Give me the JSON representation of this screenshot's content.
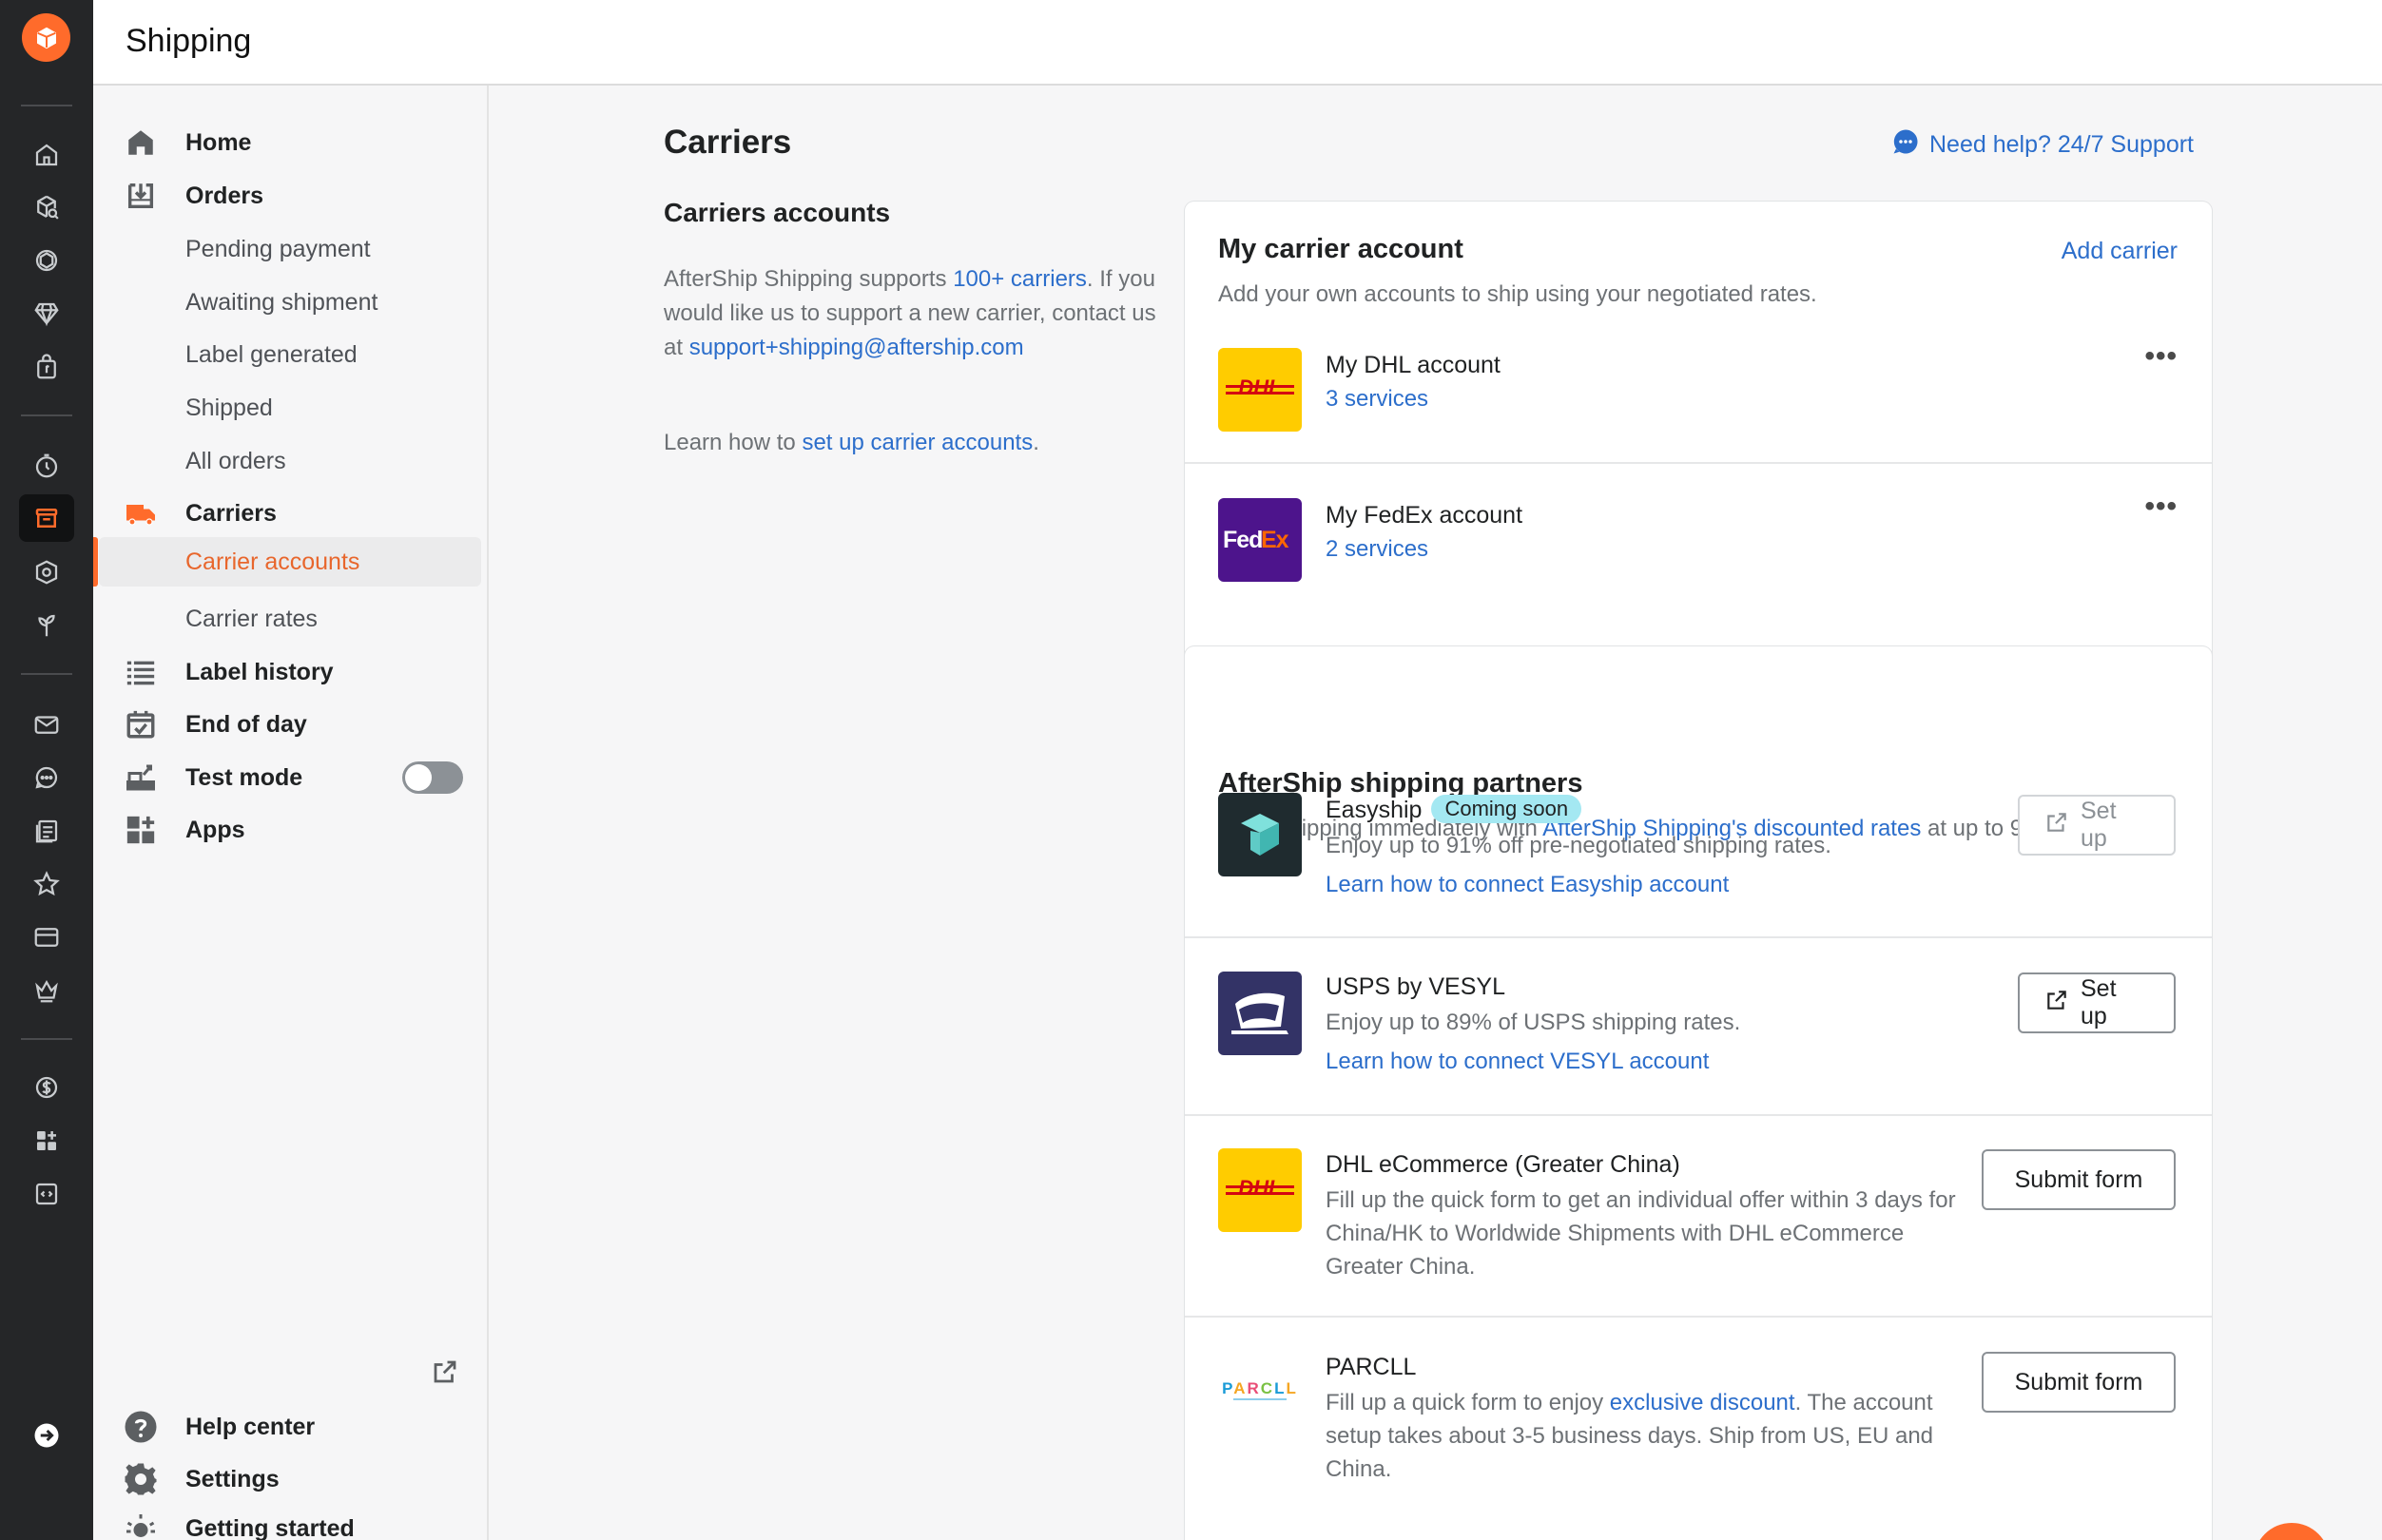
{
  "header": {
    "title": "Shipping"
  },
  "rail": {
    "groups": [
      [
        "home-icon",
        "package-search-icon",
        "lifebuoy-icon",
        "diamond-icon",
        "bag-icon"
      ],
      [
        "timer-icon",
        "shipping-box-icon",
        "shield-icon",
        "plant-icon"
      ],
      [
        "mail-icon",
        "chat-icon",
        "pages-icon",
        "star-icon",
        "card-icon",
        "crown-icon"
      ],
      [
        "dollar-icon",
        "apps-icon",
        "code-icon"
      ]
    ],
    "active": "shipping-box-icon"
  },
  "nav": {
    "items": [
      {
        "label": "Home",
        "icon": "home-icon",
        "type": "top"
      },
      {
        "label": "Orders",
        "icon": "orders-icon",
        "type": "top"
      },
      {
        "label": "Pending payment",
        "type": "sub"
      },
      {
        "label": "Awaiting shipment",
        "type": "sub"
      },
      {
        "label": "Label generated",
        "type": "sub"
      },
      {
        "label": "Shipped",
        "type": "sub"
      },
      {
        "label": "All orders",
        "type": "sub"
      },
      {
        "label": "Carriers",
        "icon": "truck-icon",
        "type": "top"
      },
      {
        "label": "Carrier accounts",
        "type": "sub",
        "selected": true
      },
      {
        "label": "Carrier rates",
        "type": "sub"
      },
      {
        "label": "Label history",
        "icon": "list-icon",
        "type": "top"
      },
      {
        "label": "End of day",
        "icon": "calendar-check-icon",
        "type": "top"
      },
      {
        "label": "Test mode",
        "icon": "test-mode-icon",
        "type": "top",
        "toggle": false
      },
      {
        "label": "Apps",
        "icon": "apps-icon",
        "type": "top"
      }
    ],
    "bottom": [
      {
        "label": "Help center",
        "icon": "help-icon"
      },
      {
        "label": "Settings",
        "icon": "gear-icon"
      },
      {
        "label": "Getting started",
        "icon": "lightbulb-icon"
      }
    ]
  },
  "main": {
    "title": "Carriers",
    "help": "Need help? 24/7 Support",
    "section": {
      "title": "Carriers accounts",
      "desc_pre": "AfterShip Shipping supports ",
      "desc_link": "100+ carriers",
      "desc_mid": ". If you would like us to support a new carrier, contact us at ",
      "email": "support+shipping@aftership.com",
      "learn_pre": "Learn how to ",
      "learn_link": "set up carrier accounts",
      "learn_post": "."
    },
    "my_accounts": {
      "title": "My carrier account",
      "action": "Add carrier",
      "subtitle": "Add your own accounts to ship using your negotiated rates.",
      "accounts": [
        {
          "name": "My DHL account",
          "services": "3 services",
          "logo": "DHL",
          "more": "•••"
        },
        {
          "name": "My FedEx account",
          "services": "2 services",
          "logo": "FedEx",
          "more": "•••"
        }
      ]
    },
    "partners": {
      "title": "AfterShip shipping partners",
      "sub_pre": "Start shipping immediately with ",
      "sub_link": "AfterShip Shipping's discounted rates",
      "sub_post": " at up to 91% off.",
      "items": [
        {
          "name": "Easyship",
          "badge": "Coming soon",
          "desc": "Enjoy up to 91% off pre-negotiated shipping rates.",
          "link": "Learn how to connect Easyship account",
          "button": "Set up"
        },
        {
          "name": "USPS by VESYL",
          "desc": "Enjoy up to 89% of USPS shipping rates.",
          "link": "Learn how to connect VESYL account",
          "button": "Set up"
        },
        {
          "name": "DHL eCommerce (Greater China)",
          "desc": "Fill up the quick form to get an individual offer within 3 days for China/HK to Worldwide Shipments with DHL eCommerce Greater China.",
          "button": "Submit form",
          "logo": "DHL"
        },
        {
          "name": "PARCLL",
          "desc_pre": "Fill up a quick form to enjoy ",
          "desc_link": "exclusive discount",
          "desc_post": ". The account setup takes about 3-5 business days. Ship from US, EU and China.",
          "button": "Submit form",
          "logo": "PARCLL"
        }
      ]
    }
  },
  "colors": {
    "accent": "#ff6b2b",
    "link": "#2c6ecb",
    "rail": "#252628",
    "dhl_yellow": "#ffcc00",
    "fedex_purple": "#4d148c",
    "usps_navy": "#333366"
  }
}
